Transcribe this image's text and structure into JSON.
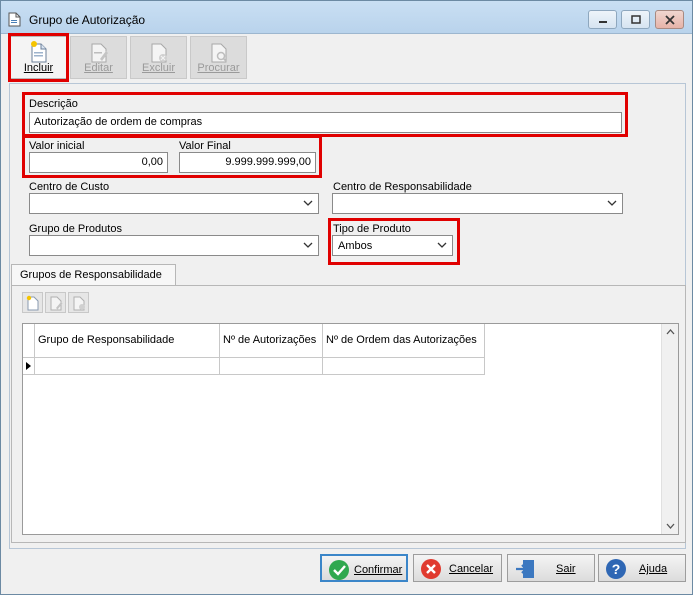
{
  "window": {
    "title": "Grupo de Autorização"
  },
  "toolbar": {
    "incluir": "Incluir",
    "editar": "Editar",
    "excluir": "Excluir",
    "procurar": "Procurar"
  },
  "form": {
    "descricao_label": "Descrição",
    "descricao_value": "Autorização de ordem de compras",
    "valor_inicial_label": "Valor inicial",
    "valor_inicial_value": "0,00",
    "valor_final_label": "Valor Final",
    "valor_final_value": "9.999.999.999,00",
    "centro_custo_label": "Centro de Custo",
    "centro_custo_value": "",
    "centro_resp_label": "Centro de Responsabilidade",
    "centro_resp_value": "",
    "grupo_produtos_label": "Grupo de Produtos",
    "grupo_produtos_value": "",
    "tipo_produto_label": "Tipo de Produto",
    "tipo_produto_value": "Ambos"
  },
  "tabs": [
    {
      "label": "Grupos de Responsabilidade"
    }
  ],
  "grid": {
    "columns": [
      "Grupo de Responsabilidade",
      "Nº de Autorizações",
      "Nº de Ordem das Autorizações"
    ],
    "rows": [
      [
        "",
        "",
        ""
      ]
    ]
  },
  "footer": {
    "confirmar": "Confirmar",
    "cancelar": "Cancelar",
    "sair": "Sair",
    "ajuda": "Ajuda"
  },
  "colors": {
    "highlight": "#e00000",
    "accent": "#3b86c9"
  }
}
